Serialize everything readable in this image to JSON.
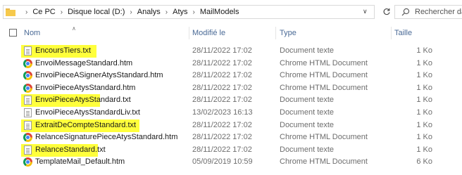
{
  "address": {
    "crumbs": [
      "Ce PC",
      "Disque local (D:)",
      "Analys",
      "Atys",
      "MailModels"
    ],
    "search_placeholder": "Rechercher dans :"
  },
  "columns": {
    "name": "Nom",
    "modified": "Modifié le",
    "type": "Type",
    "size": "Taille"
  },
  "colors": {
    "highlight": "#ffff3c",
    "header_text": "#4a6a96"
  },
  "files": [
    {
      "name": "EncoursTiers.txt",
      "modified": "28/11/2022 17:02",
      "type": "Document texte",
      "size": "1 Ko",
      "icon": "text-file-icon",
      "highlighted": true
    },
    {
      "name": "EnvoiMessageStandard.htm",
      "modified": "28/11/2022 17:02",
      "type": "Chrome HTML Document",
      "size": "1 Ko",
      "icon": "chrome-html-icon",
      "highlighted": false
    },
    {
      "name": "EnvoiPieceASignerAtysStandard.htm",
      "modified": "28/11/2022 17:02",
      "type": "Chrome HTML Document",
      "size": "1 Ko",
      "icon": "chrome-html-icon",
      "highlighted": false
    },
    {
      "name": "EnvoiPieceAtysStandard.htm",
      "modified": "28/11/2022 17:02",
      "type": "Chrome HTML Document",
      "size": "1 Ko",
      "icon": "chrome-html-icon",
      "highlighted": false
    },
    {
      "name": "EnvoiPieceAtysStandard.txt",
      "modified": "28/11/2022 17:02",
      "type": "Document texte",
      "size": "1 Ko",
      "icon": "text-file-icon",
      "highlighted": true
    },
    {
      "name": "EnvoiPieceAtysStandardLiv.txt",
      "modified": "13/02/2023 16:13",
      "type": "Document texte",
      "size": "1 Ko",
      "icon": "text-file-icon",
      "highlighted": false
    },
    {
      "name": "ExtraitDeCompteStandard.txt",
      "modified": "28/11/2022 17:02",
      "type": "Document texte",
      "size": "1 Ko",
      "icon": "text-file-icon",
      "highlighted": true
    },
    {
      "name": "RelanceSignaturePieceAtysStandard.htm",
      "modified": "28/11/2022 17:02",
      "type": "Chrome HTML Document",
      "size": "1 Ko",
      "icon": "chrome-html-icon",
      "highlighted": false
    },
    {
      "name": "RelanceStandard.txt",
      "modified": "28/11/2022 17:02",
      "type": "Document texte",
      "size": "1 Ko",
      "icon": "text-file-icon",
      "highlighted": true
    },
    {
      "name": "TemplateMail_Default.htm",
      "modified": "05/09/2019 10:59",
      "type": "Chrome HTML Document",
      "size": "6 Ko",
      "icon": "chrome-html-icon",
      "highlighted": false
    }
  ]
}
